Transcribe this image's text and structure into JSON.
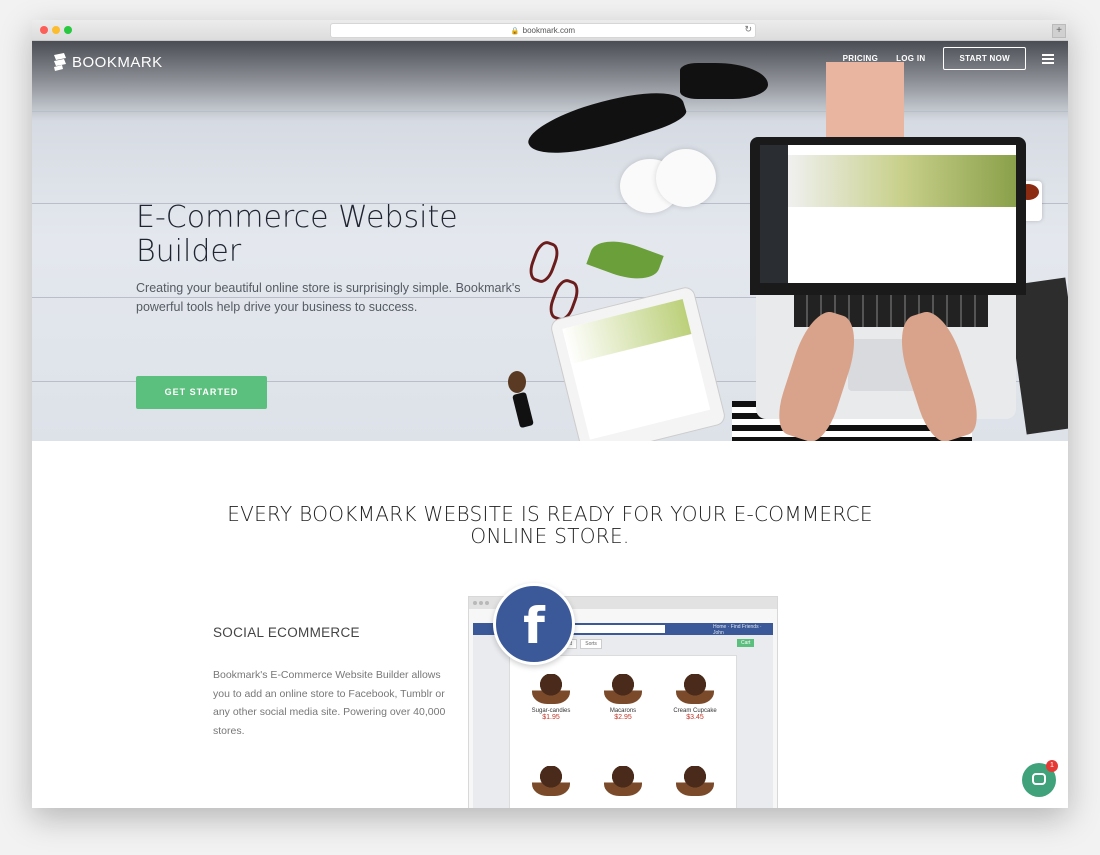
{
  "browser": {
    "url": "bookmark.com"
  },
  "nav": {
    "logo_text": "BOOKMARK",
    "pricing": "PRICING",
    "login": "LOG IN",
    "start_now": "START NOW"
  },
  "hero": {
    "title": "E-Commerce Website Builder",
    "subtitle": "Creating your beautiful online store is surprisingly simple. Bookmark's powerful tools help drive your business to success.",
    "cta": "GET STARTED"
  },
  "section": {
    "heading_line1": "EVERY BOOKMARK WEBSITE IS READY FOR YOUR E-COMMERCE",
    "heading_line2": "ONLINE STORE.",
    "feature_title": "SOCIAL ECOMMERCE",
    "feature_desc": "Bookmark's E-Commerce Website Builder allows you to add an online store to Facebook, Tumblr or any other social media site. Powering over 40,000 stores."
  },
  "mockup": {
    "fb_letter": "f",
    "products": [
      {
        "name": "Sugar-candies",
        "price": "$1.95"
      },
      {
        "name": "Macarons",
        "price": "$2.95"
      },
      {
        "name": "Cream Cupcake",
        "price": "$3.45"
      }
    ]
  },
  "chat": {
    "badge_count": "1"
  },
  "colors": {
    "accent_green": "#5bbf7d",
    "facebook_blue": "#3b5998",
    "chat_green": "#3fa27a",
    "badge_red": "#e53935"
  }
}
